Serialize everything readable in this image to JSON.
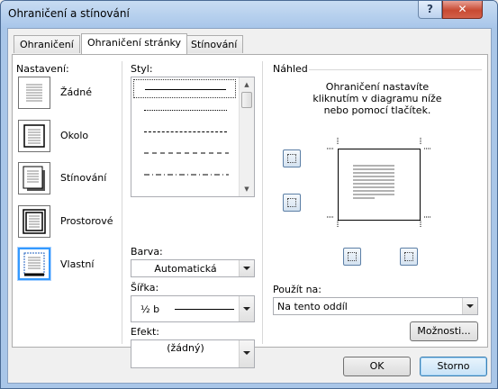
{
  "window": {
    "title": "Ohraničení a stínování",
    "help": "?",
    "close": "✕"
  },
  "tabs": [
    {
      "label": "Ohraničení",
      "accel": "O"
    },
    {
      "label": "Ohraničení stránky",
      "accel": "y"
    },
    {
      "label": "Stínování",
      "accel": "n"
    }
  ],
  "settings": {
    "header": "Nastavení:",
    "items": [
      {
        "label": "Žádné",
        "icon": "none-border-icon"
      },
      {
        "label": "Okolo",
        "icon": "box-border-icon"
      },
      {
        "label": "Stínování",
        "icon": "shadow-border-icon"
      },
      {
        "label": "Prostorové",
        "icon": "3d-border-icon"
      },
      {
        "label": "Vlastní",
        "icon": "custom-border-icon"
      }
    ],
    "selected": "Vlastní"
  },
  "style": {
    "label": "Styl:",
    "items": [
      "solid",
      "dotted",
      "dashed-small",
      "dashed",
      "dash-dot"
    ]
  },
  "color": {
    "label": "Barva:",
    "value": "Automatická"
  },
  "width": {
    "label": "Šířka:",
    "value": "½ b"
  },
  "art": {
    "label": "Efekt:",
    "value": "(žádný)"
  },
  "preview": {
    "header": "Náhled",
    "hint_lines": [
      "Ohraničení nastavíte",
      "kliknutím v diagramu níže",
      "nebo pomocí tlačítek."
    ]
  },
  "apply_to": {
    "label": "Použít na:",
    "value": "Na tento oddíl"
  },
  "buttons": {
    "options": "Možnosti...",
    "ok": "OK",
    "cancel": "Storno"
  }
}
